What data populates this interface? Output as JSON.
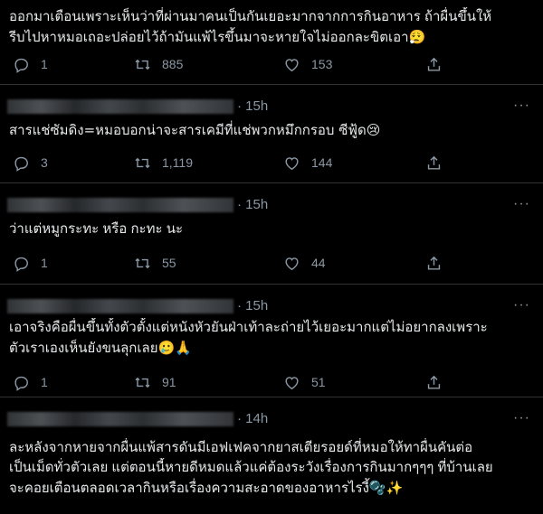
{
  "tweets": [
    {
      "lines": [
        "ออกมาเตือนเพราะเห็นว่าที่ผ่านมาคนเป็นกันเยอะมากจากการกินอาหาร ถ้าผื่นขึ้นให้",
        "รีบไปหาหมอเถอะปล่อยไว้ถ้ามันแพ้ไรขึ้นมาจะหายใจไม่ออกละขิตเอา😮‍💨"
      ],
      "replies": "1",
      "retweets": "885",
      "likes": "153"
    },
    {
      "time": "· 15h",
      "lines": [
        "สารแช่ซัมดิง=หมอบอกน่าจะสารเคมีที่แช่พวกหมึกกรอบ ซีฟู้ด😢"
      ],
      "replies": "3",
      "retweets": "1,119",
      "likes": "144"
    },
    {
      "time": "· 15h",
      "lines": [
        "ว่าแต่หมูกระทะ หรือ กะทะ นะ"
      ],
      "replies": "1",
      "retweets": "55",
      "likes": "44"
    },
    {
      "time": "· 15h",
      "lines": [
        "เอาจริงคือผื่นขึ้นทั้งตัวตั้งแต่หนังหัวยันฝ่าเท้าละถ่ายไว้เยอะมากแต่ไม่อยากลงเพราะ",
        "ตัวเราเองเห็นยังขนลุกเลย🥲🙏"
      ],
      "replies": "1",
      "retweets": "91",
      "likes": "51"
    },
    {
      "time": "· 14h",
      "lines": [
        "ละหลังจากหายจากผื่นแพ้สารดันมีเอฟเฟคจากยาสเตียรอยด์ที่หมอให้ทาผื่นคันต่อ",
        "เป็นเม็ดทั่วตัวเลย แต่ตอนนี้หายดีหมดแล้วแค่ต้องระวังเรื่องการกินมากๆๆๆ ที่บ้านเลย",
        "จะคอยเตือนตลอดเวลากินหรือเรื่องความสะอาดของอาหารไรงี้🫧✨"
      ]
    }
  ],
  "icons": {
    "reply": "reply-icon",
    "retweet": "retweet-icon",
    "like": "like-icon",
    "share": "share-icon",
    "more": "more-options-icon"
  },
  "colors": {
    "background": "#000000",
    "text": "#e7e9ea",
    "muted": "#8b98a5",
    "divider": "#2f3336"
  }
}
